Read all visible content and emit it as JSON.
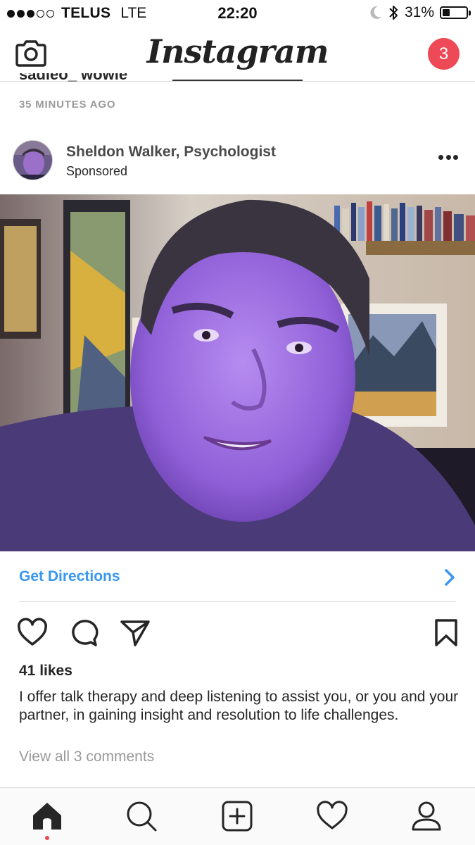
{
  "status_bar": {
    "carrier": "TELUS",
    "network": "LTE",
    "time": "22:20",
    "battery_percent": "31%",
    "battery_level": 0.31,
    "signal_bars_filled": 3,
    "signal_bars_total": 5,
    "icons": [
      "moon-icon",
      "bluetooth-icon",
      "battery-icon"
    ]
  },
  "header": {
    "logo": "Instagram",
    "notification_count": "3",
    "icons": [
      "camera-icon"
    ]
  },
  "previous_post": {
    "username": "sadieo_ wowie",
    "timestamp": "35 MINUTES AGO"
  },
  "post": {
    "author": "Sheldon Walker, Psychologist",
    "label": "Sponsored",
    "cta_label": "Get Directions",
    "likes": "41 likes",
    "caption": "I offer talk therapy and deep listening to assist you, or you and your partner, in gaining insight and resolution to life challenges.",
    "comments_link": "View all 3 comments"
  },
  "colors": {
    "accent_blue": "#3897f0",
    "badge_red": "#ed4956",
    "muted_text": "#999999",
    "divider": "#dbdbdb"
  },
  "tab_bar": {
    "items": [
      "home-icon",
      "search-icon",
      "add-post-icon",
      "activity-heart-icon",
      "profile-icon"
    ],
    "active": "home-icon"
  }
}
